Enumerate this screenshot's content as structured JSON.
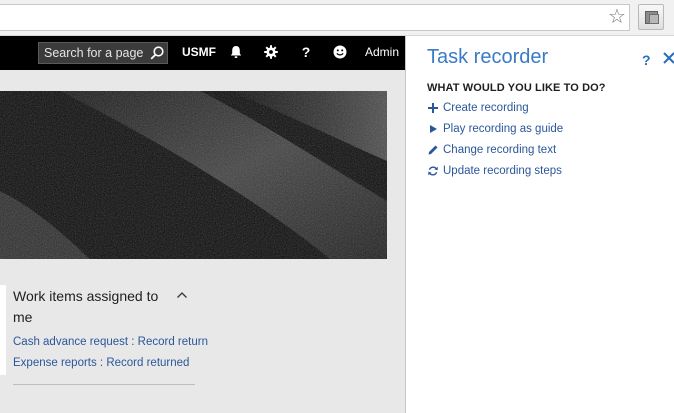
{
  "browser": {
    "star_icon": "star-outline-icon",
    "extension_icon": "extension-icon"
  },
  "navbar": {
    "search_placeholder": "Search for a page",
    "company": "USMF",
    "help_glyph": "?",
    "user": "Admin",
    "icons": [
      "search-icon",
      "bell-icon",
      "gear-icon",
      "help-icon",
      "smiley-icon"
    ]
  },
  "workspace": {
    "card": {
      "title": "Work items assigned to me",
      "links": [
        "Cash advance request : Record return",
        "Expense reports : Record returned"
      ]
    }
  },
  "task_recorder": {
    "title": "Task recorder",
    "help_glyph": "?",
    "heading": "WHAT WOULD YOU LIKE TO DO?",
    "actions": [
      {
        "label": "Create recording",
        "icon": "plus-icon"
      },
      {
        "label": "Play recording as guide",
        "icon": "play-icon"
      },
      {
        "label": "Change recording text",
        "icon": "pencil-icon"
      },
      {
        "label": "Update recording steps",
        "icon": "refresh-icon"
      }
    ]
  },
  "colors": {
    "accent": "#2b579a",
    "pane_title": "#3a7bc6",
    "navbar": "#000000",
    "workspace_bg": "#e8e8e8"
  }
}
